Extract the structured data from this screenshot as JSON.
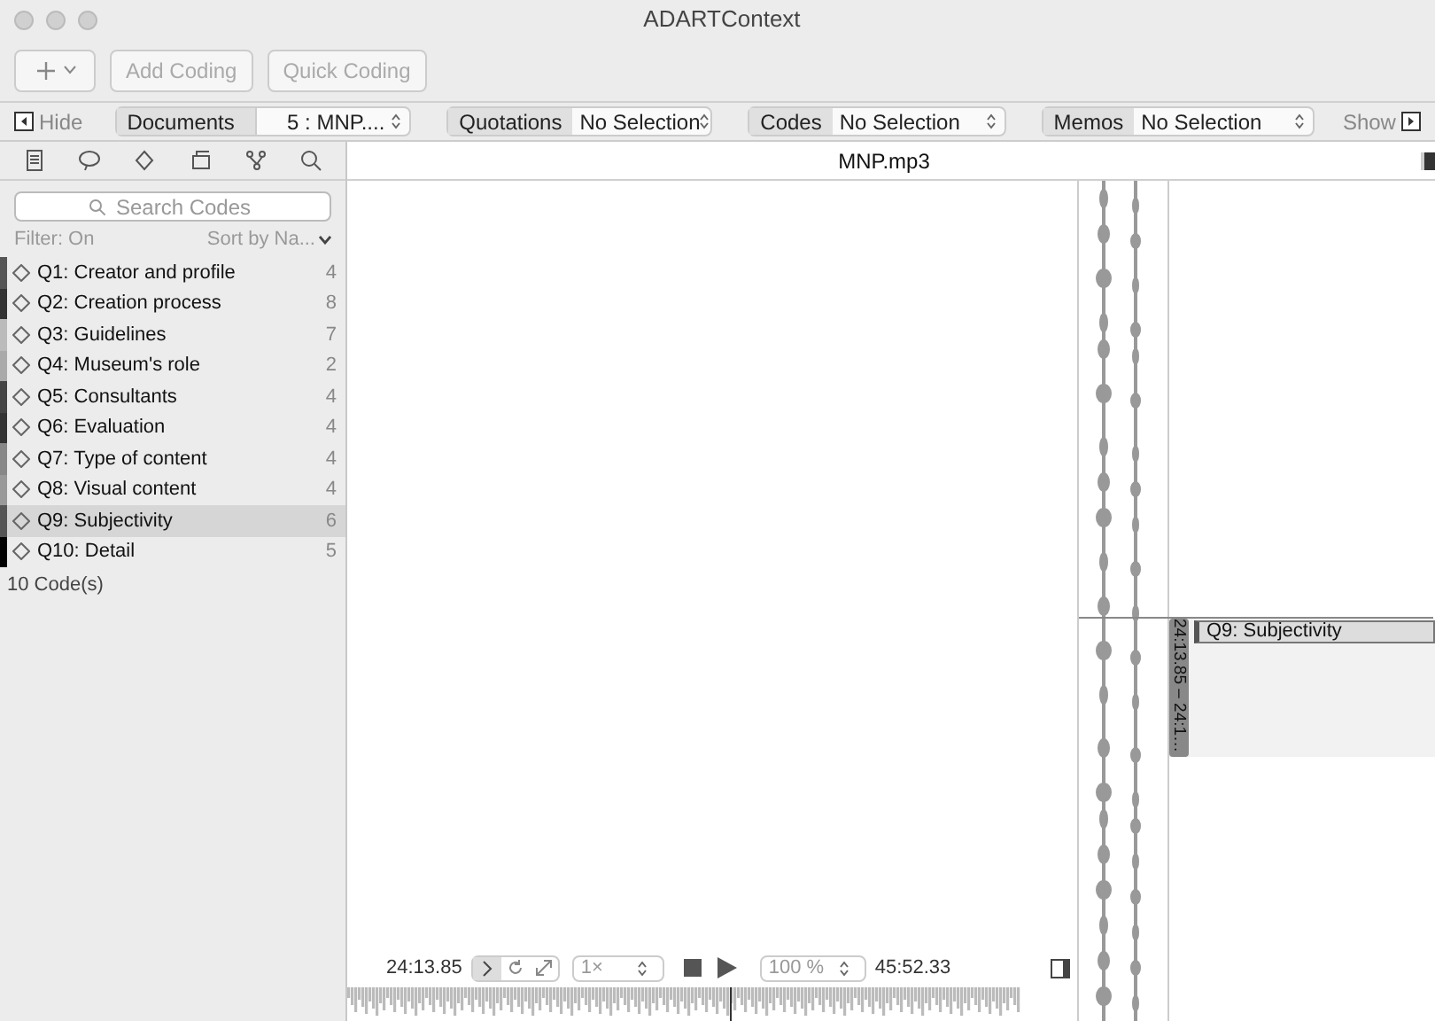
{
  "window": {
    "title": "ADARTContext"
  },
  "toolbar": {
    "buttons": [
      {
        "label": "Add Coding",
        "disabled": true
      },
      {
        "label": "Quick Coding",
        "disabled": true
      }
    ]
  },
  "navigator": {
    "hide": "Hide",
    "show": "Show",
    "selectors": [
      {
        "label": "Documents",
        "value": "5 : MNP...."
      },
      {
        "label": "Quotations",
        "value": "No Selection"
      },
      {
        "label": "Codes",
        "value": "No Selection"
      },
      {
        "label": "Memos",
        "value": "No Selection"
      }
    ]
  },
  "sidebar": {
    "search": {
      "placeholder": "Search Codes"
    },
    "filter": "Filter: On",
    "sort": "Sort by Na...",
    "codes": [
      {
        "name": "Q1: Creator and profile",
        "count": "4",
        "color": "#555555",
        "selected": false
      },
      {
        "name": "Q2: Creation process",
        "count": "8",
        "color": "#333333",
        "selected": false
      },
      {
        "name": "Q3: Guidelines",
        "count": "7",
        "color": "#bbbbbb",
        "selected": false
      },
      {
        "name": "Q4: Museum's role",
        "count": "2",
        "color": "#aaaaaa",
        "selected": false
      },
      {
        "name": "Q5: Consultants",
        "count": "4",
        "color": "#444444",
        "selected": false
      },
      {
        "name": "Q6: Evaluation",
        "count": "4",
        "color": "#333333",
        "selected": false
      },
      {
        "name": "Q7: Type of content",
        "count": "4",
        "color": "#888888",
        "selected": false
      },
      {
        "name": "Q8: Visual content",
        "count": "4",
        "color": "#999999",
        "selected": false
      },
      {
        "name": "Q9: Subjectivity",
        "count": "6",
        "color": "#555555",
        "selected": true
      },
      {
        "name": "Q10: Detail",
        "count": "5",
        "color": "#000000",
        "selected": false
      }
    ],
    "footer": "10 Code(s)"
  },
  "document": {
    "title": "MNP.mp3"
  },
  "margin": {
    "range": "24:13.85 – 24:1…",
    "code": "Q9: Subjectivity"
  },
  "transport": {
    "position": "24:13.85",
    "speed": "1×",
    "zoom": "100 %",
    "duration": "45:52.33"
  }
}
